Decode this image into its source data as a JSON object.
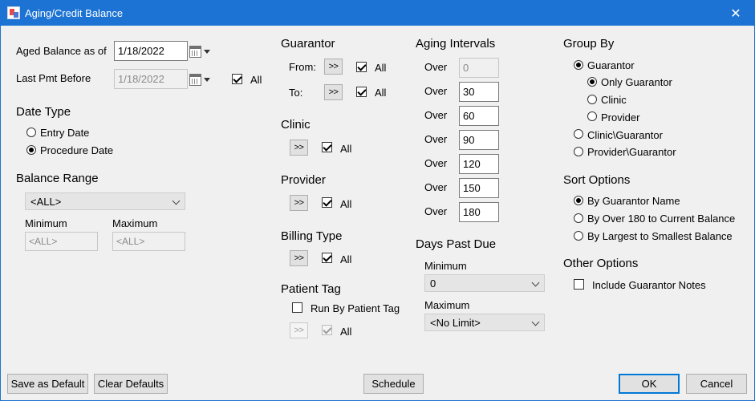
{
  "window": {
    "title": "Aging/Credit Balance",
    "close_glyph": "✕",
    "app_icon": "report-icon"
  },
  "aged_balance": {
    "label": "Aged Balance as of",
    "value": "1/18/2022"
  },
  "last_pmt": {
    "label": "Last Pmt Before",
    "value": "1/18/2022",
    "all_label": "All"
  },
  "date_type": {
    "heading": "Date Type",
    "options": [
      "Entry Date",
      "Procedure Date"
    ],
    "selected": "Procedure Date"
  },
  "balance_range": {
    "heading": "Balance Range",
    "combo_value": "<ALL>",
    "min_label": "Minimum",
    "max_label": "Maximum",
    "min_value": "<ALL>",
    "max_value": "<ALL>"
  },
  "guarantor": {
    "heading": "Guarantor",
    "from_label": "From:",
    "to_label": "To:",
    "btn": ">>",
    "all_label": "All"
  },
  "clinic": {
    "heading": "Clinic",
    "btn": ">>",
    "all_label": "All"
  },
  "provider": {
    "heading": "Provider",
    "btn": ">>",
    "all_label": "All"
  },
  "billing_type": {
    "heading": "Billing Type",
    "btn": ">>",
    "all_label": "All"
  },
  "patient_tag": {
    "heading": "Patient Tag",
    "run_label": "Run By Patient Tag",
    "btn": ">>",
    "all_label": "All"
  },
  "aging_intervals": {
    "heading": "Aging Intervals",
    "over_label": "Over",
    "values": [
      "0",
      "30",
      "60",
      "90",
      "120",
      "150",
      "180"
    ]
  },
  "days_past_due": {
    "heading": "Days Past Due",
    "min_label": "Minimum",
    "min_value": "0",
    "max_label": "Maximum",
    "max_value": "<No Limit>"
  },
  "group_by": {
    "heading": "Group By",
    "guarantor": "Guarantor",
    "only_guarantor": "Only Guarantor",
    "clinic": "Clinic",
    "provider": "Provider",
    "clinic_guarantor": "Clinic\\Guarantor",
    "provider_guarantor": "Provider\\Guarantor"
  },
  "sort_options": {
    "heading": "Sort Options",
    "options": [
      "By Guarantor Name",
      "By Over 180 to Current Balance",
      "By Largest to Smallest Balance"
    ],
    "selected": "By Guarantor Name"
  },
  "other_options": {
    "heading": "Other Options",
    "include_notes": "Include Guarantor Notes"
  },
  "footer": {
    "save_default": "Save as Default",
    "clear_defaults": "Clear Defaults",
    "schedule": "Schedule",
    "ok": "OK",
    "cancel": "Cancel"
  }
}
